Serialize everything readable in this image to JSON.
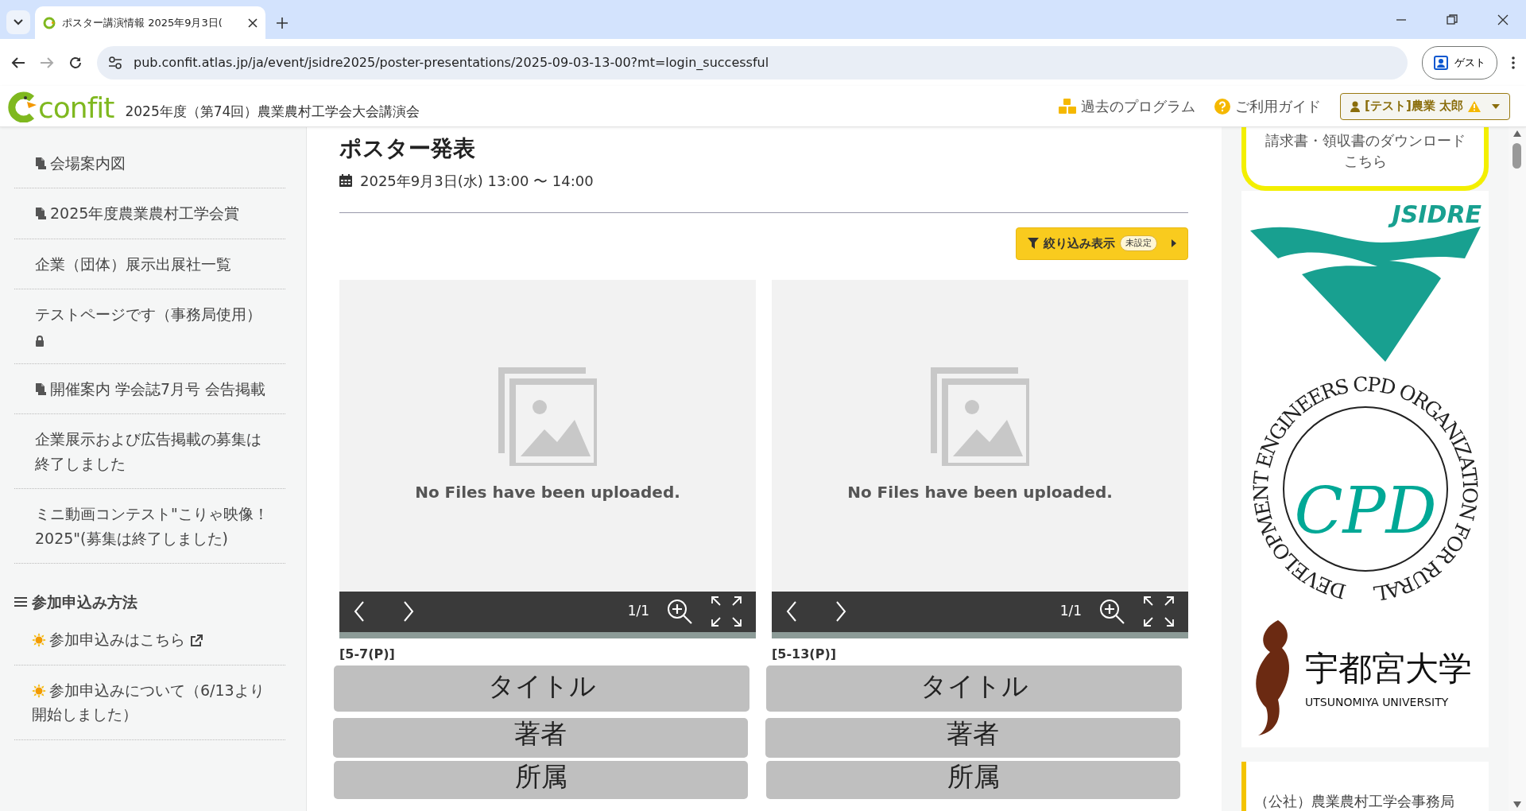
{
  "browser": {
    "tab_title": "ポスター講演情報 2025年9月3日(",
    "address": "pub.confit.atlas.jp/ja/event/jsidre2025/poster-presentations/2025-09-03-13-00?mt=login_successful",
    "profile": "ゲスト"
  },
  "header": {
    "logo": "confit",
    "event_title": "2025年度（第74回）農業農村工学会大会講演会",
    "links": [
      {
        "label": "過去のプログラム",
        "kind": "boxes"
      },
      {
        "label": "ご利用ガイド",
        "kind": "help"
      }
    ],
    "user": "[テスト]農業 太郎",
    "warning": true
  },
  "sidebar": {
    "items": [
      {
        "label": "会場案内図",
        "kind": "pdf"
      },
      {
        "label": "2025年度農業農村工学会賞",
        "kind": "pdf"
      },
      {
        "label": "企業（団体）展示出展社一覧",
        "kind": "text"
      },
      {
        "label": "テストページです（事務局使用）",
        "kind": "locked"
      },
      {
        "label": "開催案内 学会誌7月号 会告掲載",
        "kind": "pdf"
      },
      {
        "label": "企業展示および広告掲載の募集は終了しました",
        "kind": "text"
      },
      {
        "label": "ミニ動画コンテスト\"こりゃ映像！2025\"(募集は終了しました)",
        "kind": "text"
      }
    ],
    "section": "参加申込み方法",
    "section_items": [
      {
        "label": "参加申込みはこちら",
        "external": true
      },
      {
        "label": "参加申込みについて（6/13より開始しました）",
        "external": false
      }
    ]
  },
  "main": {
    "title": "ポスター発表",
    "date": "2025年9月3日(水) 13:00 〜 14:00",
    "filter": {
      "label": "絞り込み表示",
      "status": "未設定"
    },
    "posters": [
      {
        "message": "No Files have been uploaded.",
        "page": "1/1",
        "code": "[5-7(P)]",
        "title": "タイトル",
        "author": "著者",
        "affiliation": "所属"
      },
      {
        "message": "No Files have been uploaded.",
        "page": "1/1",
        "code": "[5-13(P)]",
        "title": "タイトル",
        "author": "著者",
        "affiliation": "所属"
      }
    ]
  },
  "right": {
    "banner_lines": [
      "請求書・領収書のダウンロード",
      "こちら"
    ],
    "logos": [
      {
        "kind": "jsidre",
        "text": "JSIDRE"
      },
      {
        "kind": "cpd",
        "ring_text": "DEVELOPMENT ENGINEERS CPD ORGANIZATION FOR RURAL",
        "letters": "CPD"
      },
      {
        "kind": "university",
        "name": "宇都宮大学",
        "name_en": "UTSUNOMIYA UNIVERSITY"
      }
    ],
    "office": "（公社）農業農村工学会事務局"
  }
}
